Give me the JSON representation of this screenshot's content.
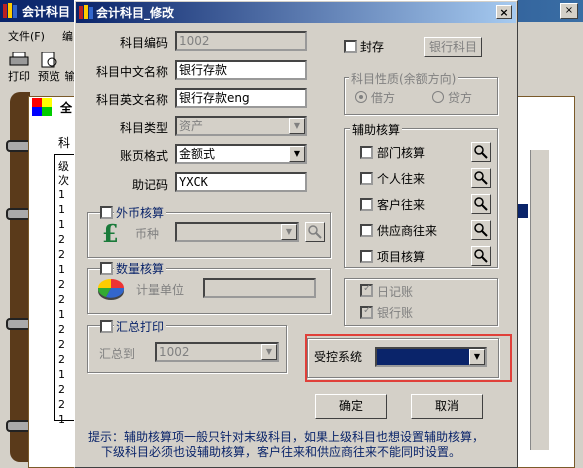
{
  "background_window": {
    "title": "会计科目",
    "menu": [
      "文件(F)",
      "编"
    ],
    "toolbar": [
      "打印",
      "预览",
      "输"
    ],
    "tab_label": "全",
    "column_label": "科",
    "grid_header": [
      "级",
      "次"
    ],
    "grid_values": [
      "1",
      "1",
      "1",
      "2",
      "2",
      "1",
      "2",
      "2",
      "1",
      "2",
      "2",
      "2",
      "1",
      "2",
      "2",
      "1"
    ]
  },
  "dialog": {
    "title": "会计科目_修改",
    "close": "×",
    "fields": {
      "code": {
        "label": "科目编码",
        "value": "1002"
      },
      "name_cn": {
        "label": "科目中文名称",
        "value": "银行存款"
      },
      "name_en": {
        "label": "科目英文名称",
        "value": "银行存款eng"
      },
      "type": {
        "label": "科目类型",
        "value": "资产"
      },
      "format": {
        "label": "账页格式",
        "value": "金额式"
      },
      "mnemonic": {
        "label": "助记码",
        "value": "YXCK"
      }
    },
    "seal": {
      "label": "封存",
      "button": "银行科目"
    },
    "nature": {
      "title": "科目性质(余额方向)",
      "debit": "借方",
      "credit": "贷方",
      "selected": "借方"
    },
    "aux": {
      "title": "辅助核算",
      "items": [
        "部门核算",
        "个人往来",
        "客户往来",
        "供应商往来",
        "项目核算"
      ]
    },
    "journals": {
      "daily": "日记账",
      "bank": "银行账"
    },
    "foreign": {
      "title": "外币核算",
      "currency_label": "币种",
      "currency_value": ""
    },
    "quantity": {
      "title": "数量核算",
      "unit_label": "计量单位",
      "unit_value": ""
    },
    "summary": {
      "title": "汇总打印",
      "to_label": "汇总到",
      "to_value": "1002"
    },
    "controlled": {
      "label": "受控系统",
      "value": ""
    },
    "buttons": {
      "ok": "确定",
      "cancel": "取消"
    },
    "hint_line1": "提示：辅助核算项一般只针对末级科目，如果上级科目也想设置辅助核算，",
    "hint_line2": "下级科目必须也设辅助核算，客户往来和供应商往来不能同时设置。"
  },
  "colors": {
    "title_bar": "#0a246a",
    "highlight_box": "#e0403a",
    "hint_text": "#0a246a"
  }
}
